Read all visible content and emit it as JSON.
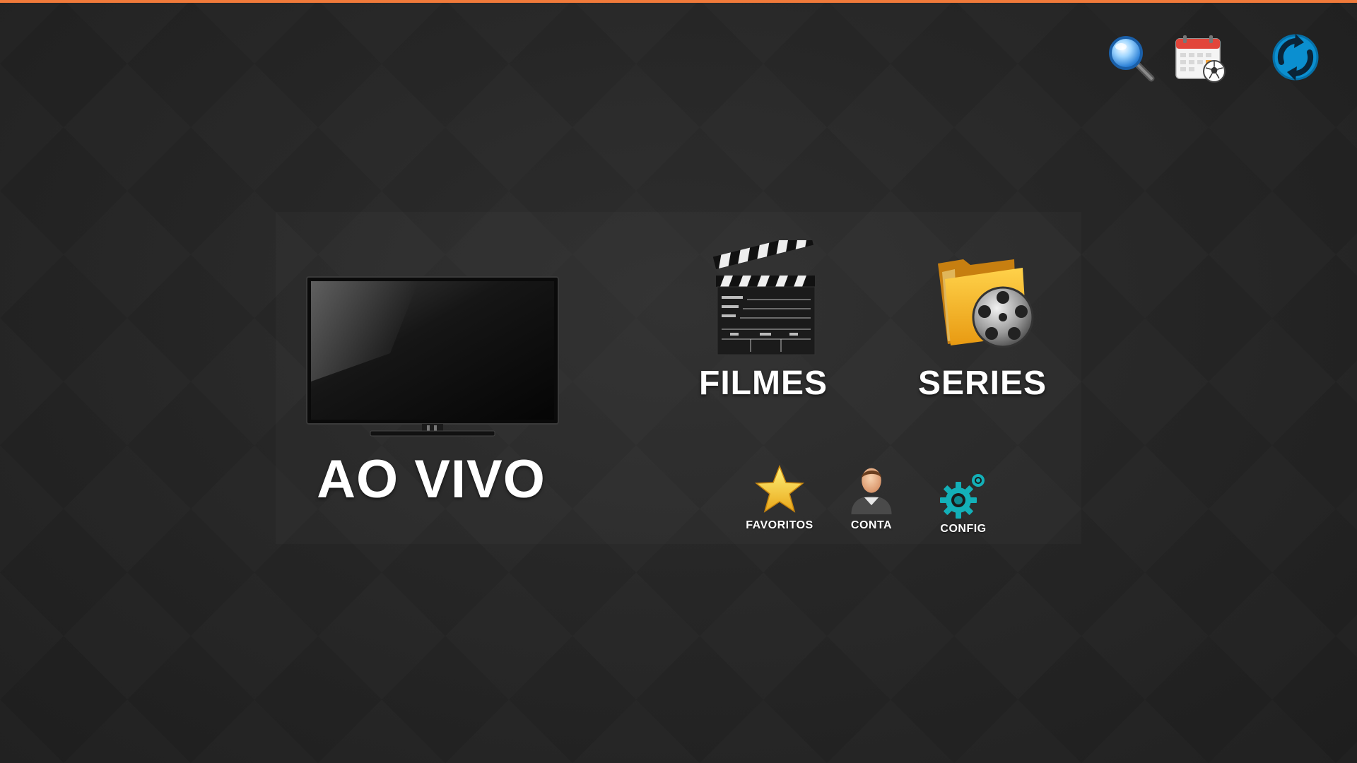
{
  "theme": {
    "accent": "#f07a3a",
    "text": "#ffffff"
  },
  "top_actions": {
    "search_icon": "search-icon",
    "calendar_icon": "sports-calendar-icon",
    "refresh_icon": "refresh-icon"
  },
  "menu": {
    "live": {
      "label": "AO VIVO",
      "icon": "tv-icon"
    },
    "movies": {
      "label": "FILMES",
      "icon": "clapperboard-icon"
    },
    "series": {
      "label": "SERIES",
      "icon": "film-folder-icon"
    },
    "favorites": {
      "label": "FAVORITOS",
      "icon": "star-icon"
    },
    "account": {
      "label": "CONTA",
      "icon": "user-icon"
    },
    "settings": {
      "label": "CONFIG",
      "icon": "gear-icon"
    }
  }
}
